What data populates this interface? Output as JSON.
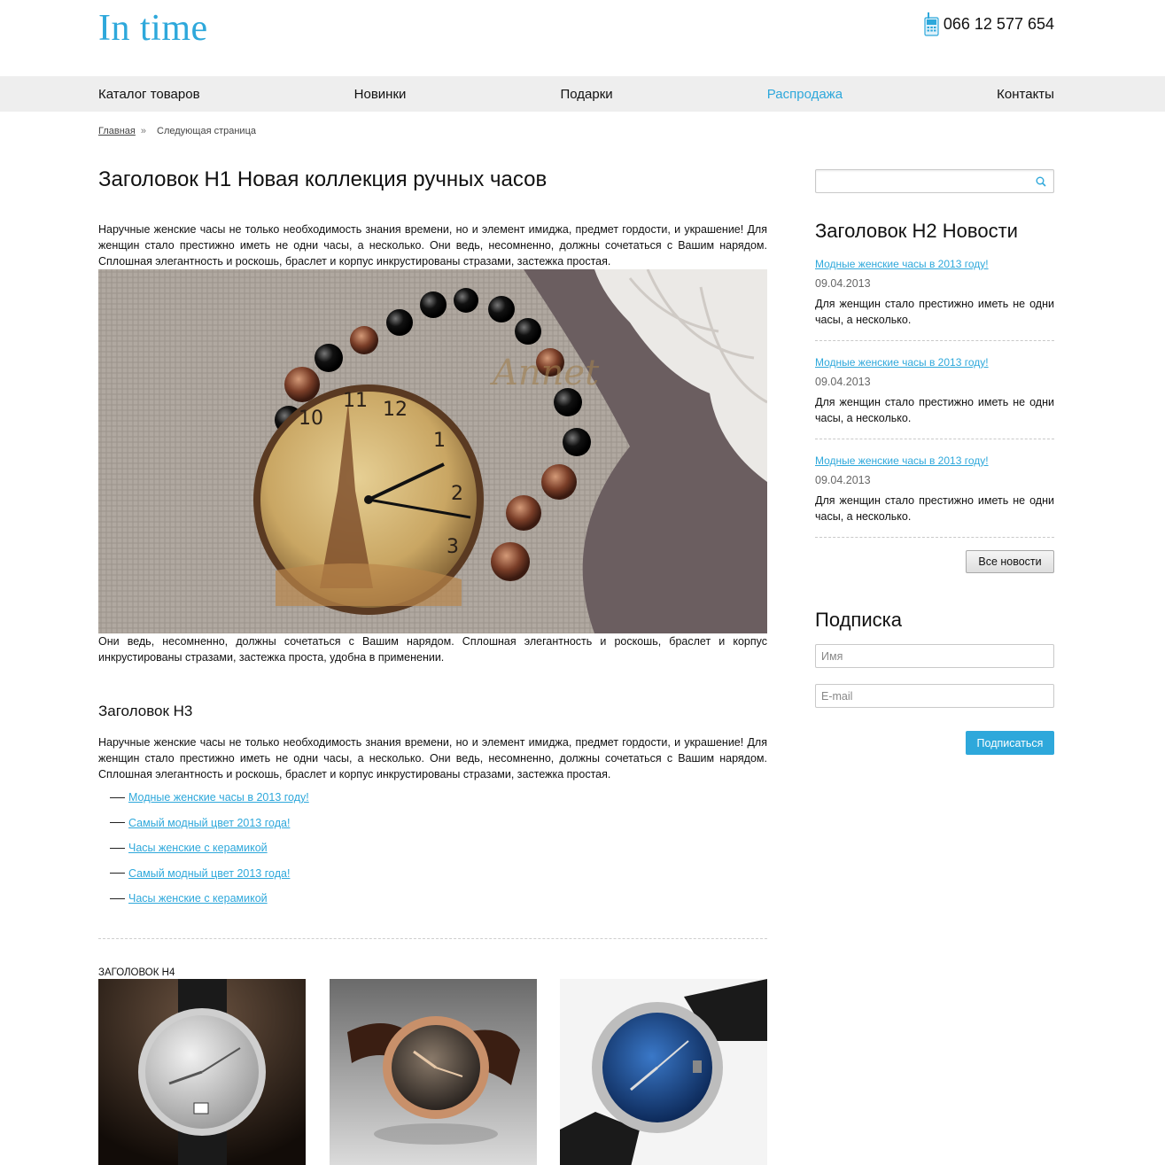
{
  "header": {
    "logo": "In time",
    "phone": "066 12 577 654"
  },
  "nav": {
    "items": [
      {
        "label": "Каталог товаров",
        "active": false
      },
      {
        "label": "Новинки",
        "active": false
      },
      {
        "label": "Подарки",
        "active": false
      },
      {
        "label": "Распродажа",
        "active": true
      },
      {
        "label": "Контакты",
        "active": false
      }
    ]
  },
  "breadcrumb": {
    "home": "Главная",
    "separator": "»",
    "current": "Следующая страница"
  },
  "main": {
    "h1": "Заголовок Н1 Новая коллекция ручных часов",
    "intro": "Наручные женские часы не только необходимость знания времени, но и элемент имиджа, предмет гордости, и украшение! Для женщин стало престижно иметь не одни часы, а несколько. Они ведь, несомненно, должны сочетаться с Вашим нарядом. Сплошная элегантность и роскошь, браслет и корпус инкрустированы стразами, застежка простая.",
    "hero_caption": "Они ведь, несомненно, должны сочетаться с Вашим нарядом. Сплошная элегантность и роскошь, браслет и корпус инкрустированы стразами, застежка проста, удобна в применении.",
    "h3": "Заголовок Н3",
    "para2": "Наручные женские часы не только необходимость знания времени, но и элемент имиджа, предмет гордости, и украшение! Для женщин стало престижно иметь не одни часы, а несколько. Они ведь, несомненно, должны сочетаться с Вашим нарядом. Сплошная элегантность и роскошь, браслет и корпус инкрустированы стразами, застежка простая.",
    "links": [
      "Модные женские часы в 2013 году!",
      "Самый модный цвет 2013 года!",
      "Часы женские с керамикой",
      "Самый модный цвет 2013 года!",
      "Часы женские с керамикой"
    ],
    "h4": "ЗАГОЛОВОК Н4"
  },
  "sidebar": {
    "search": {
      "placeholder": "",
      "value": ""
    },
    "news_title": "Заголовок Н2 Новости",
    "news": [
      {
        "title": "Модные женские часы в 2013 году!",
        "date": "09.04.2013",
        "text": "Для женщин стало престижно иметь не одни часы, а несколько."
      },
      {
        "title": "Модные женские часы в 2013 году!",
        "date": "09.04.2013",
        "text": "Для женщин стало престижно иметь не одни часы, а несколько."
      },
      {
        "title": "Модные женские часы в 2013 году!",
        "date": "09.04.2013",
        "text": "Для женщин стало престижно иметь не одни часы, а несколько."
      }
    ],
    "all_news_button": "Все новости",
    "subscribe_title": "Подписка",
    "name_placeholder": "Имя",
    "email_placeholder": "E-mail",
    "subscribe_button": "Подписаться"
  },
  "colors": {
    "accent": "#2ea8db",
    "nav_bg": "#eeeeee"
  }
}
